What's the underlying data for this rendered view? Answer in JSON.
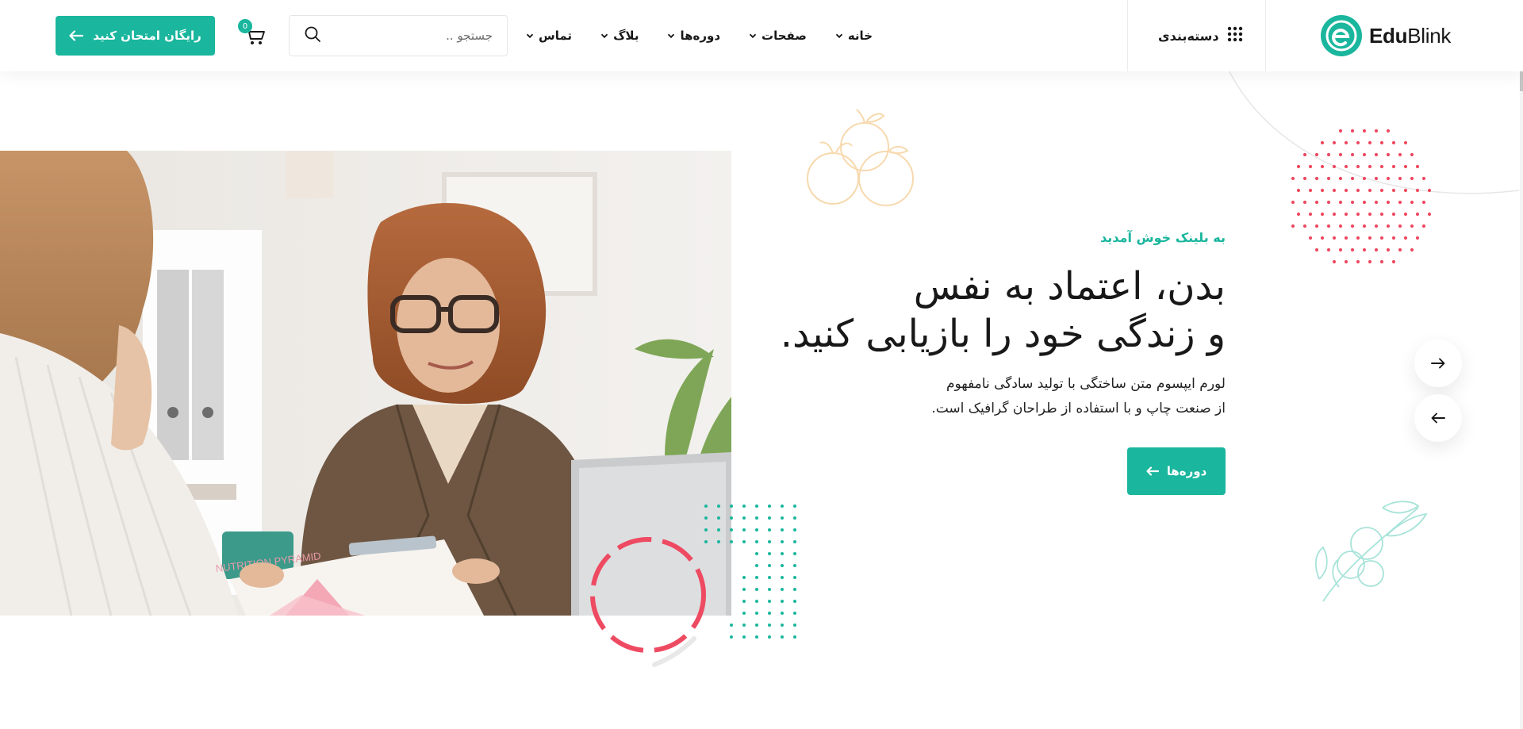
{
  "brand": {
    "name_bold": "Edu",
    "name_light": "Blink",
    "color": "#1ab69d"
  },
  "header": {
    "category_label": "دسته‌بندی",
    "nav": [
      {
        "label": "خانه"
      },
      {
        "label": "صفحات"
      },
      {
        "label": "دوره‌ها"
      },
      {
        "label": "بلاگ"
      },
      {
        "label": "تماس"
      }
    ],
    "search_placeholder": "جستجو ..",
    "cart_count": "0",
    "cta_label": "رایگان امتحان کنید"
  },
  "hero": {
    "eyebrow": "به بلینک خوش آمدید",
    "title_line1": "بدن، اعتماد به نفس",
    "title_line2": "و زندگی خود را بازیابی کنید.",
    "desc_line1": "لورم ایپسوم متن ساختگی با تولید سادگی نامفهوم",
    "desc_line2": "از صنعت چاپ و با استفاده از طراحان گرافیک است.",
    "button_label": "دوره‌ها",
    "image_text": "NUTRITION PYRAMID"
  },
  "colors": {
    "accent": "#1ab69d",
    "coral": "#ee4a62",
    "peach": "#f7d9ae",
    "mint": "#a7e3d9"
  },
  "icons": [
    "grid-icon",
    "chevron-down-icon",
    "search-icon",
    "cart-icon",
    "arrow-left-icon",
    "arrow-right-icon"
  ]
}
